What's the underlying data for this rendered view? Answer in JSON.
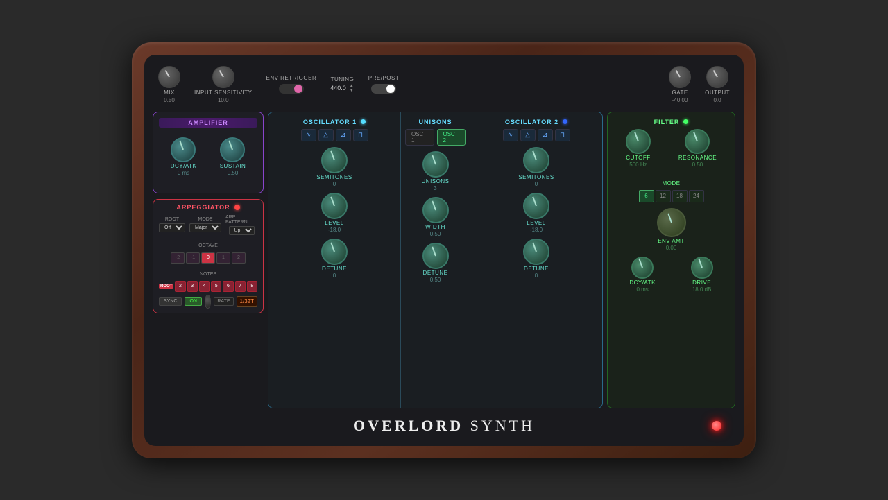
{
  "brand": {
    "name_bold": "OVERLORD",
    "name_light": " SYNTH"
  },
  "top_bar": {
    "mix_label": "MIX",
    "mix_value": "0.50",
    "input_sensitivity_label": "INPUT SENSITIVITY",
    "input_sensitivity_value": "10.0",
    "env_retrigger_label": "ENV RETRIGGER",
    "tuning_label": "TUNING",
    "tuning_value": "440.0",
    "pre_post_label": "PRE/POST",
    "gate_label": "GATE",
    "gate_value": "-40.00",
    "output_label": "OUTPUT",
    "output_value": "0.0"
  },
  "amplifier": {
    "title": "AMPLIFIER",
    "dcy_atk_label": "DCY/ATK",
    "dcy_atk_value": "0 ms",
    "sustain_label": "SUSTAIN",
    "sustain_value": "0.50"
  },
  "arpeggiator": {
    "title": "ARPEGGIATOR",
    "root_label": "ROOT",
    "root_value": "Off",
    "mode_label": "MODE",
    "mode_value": "Major",
    "arp_pattern_label": "ARP PATTERN",
    "arp_pattern_value": "Up",
    "octave_label": "OCTAVE",
    "octave_btns": [
      "-2",
      "-1",
      "0",
      "1",
      "2"
    ],
    "octave_active": "0",
    "notes_label": "NOTES",
    "notes": [
      "ROOT",
      "2",
      "3",
      "4",
      "5",
      "6",
      "7",
      "8"
    ],
    "sync_label": "SYNC",
    "on_label": "ON",
    "rate_label": "RATE",
    "rate_value": "1/32T"
  },
  "oscillator1": {
    "title": "OSCILLATOR 1",
    "semitones_label": "SEMITONES",
    "semitones_value": "0",
    "level_label": "LEVEL",
    "level_value": "-18.0",
    "detune_label": "DETUNE",
    "detune_value": "0",
    "waveforms": [
      "sin",
      "tri",
      "saw",
      "sqr"
    ],
    "indicator_active": true
  },
  "unisons": {
    "title": "UNISONS",
    "osc1_tab": "OSC 1",
    "osc2_tab": "OSC 2",
    "unisons_label": "UNISONS",
    "unisons_value": "3",
    "width_label": "WIDTH",
    "width_value": "0.50",
    "detune_label": "DETUNE",
    "detune_value": "0.50"
  },
  "oscillator2": {
    "title": "OSCILLATOR 2",
    "semitones_label": "SEMITONES",
    "semitones_value": "0",
    "level_label": "LEVEL",
    "level_value": "-18.0",
    "detune_label": "DETUNE",
    "detune_value": "0",
    "waveforms": [
      "sin",
      "tri",
      "saw",
      "sqr"
    ],
    "indicator_active": true
  },
  "filter": {
    "title": "FILTER",
    "cutoff_label": "CUTOFF",
    "cutoff_value": "500 Hz",
    "resonance_label": "RESONANCE",
    "resonance_value": "0.50",
    "mode_label": "MODE",
    "mode_btns": [
      "6",
      "12",
      "18",
      "24"
    ],
    "mode_active": "6",
    "env_amt_label": "ENV AMT",
    "env_amt_value": "0.00",
    "dcy_atk_label": "DCY/ATK",
    "dcy_atk_value": "0 ms",
    "drive_label": "DRIVE",
    "drive_value": "18.0 dB",
    "indicator_active": true
  }
}
